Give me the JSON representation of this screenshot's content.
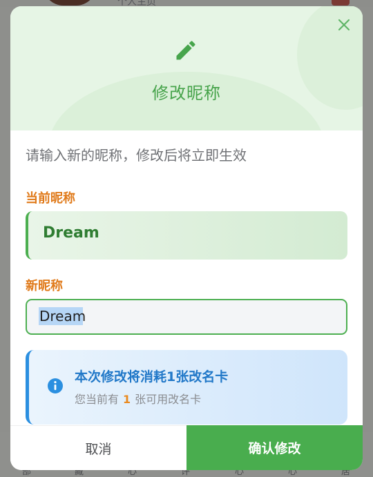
{
  "background": {
    "top_text": "个人主页",
    "tabs": [
      "部",
      "藏",
      "心",
      "评",
      "心",
      "心",
      "居"
    ]
  },
  "modal": {
    "title": "修改昵称",
    "subtitle": "请输入新的昵称，修改后将立即生效",
    "current_label": "当前昵称",
    "current_value": "Dream",
    "new_label": "新昵称",
    "new_value": "Dream",
    "info": {
      "title": "本次修改将消耗1张改名卡",
      "sub_prefix": "您当前有",
      "count": "1",
      "sub_suffix": "张可用改名卡"
    },
    "cancel_label": "取消",
    "confirm_label": "确认修改"
  },
  "colors": {
    "accent_green": "#4caf50",
    "title_green": "#46a34a",
    "label_orange": "#e07a1a",
    "info_blue": "#2178c8"
  },
  "icons": [
    "pencil-icon",
    "close-icon",
    "info-icon"
  ]
}
